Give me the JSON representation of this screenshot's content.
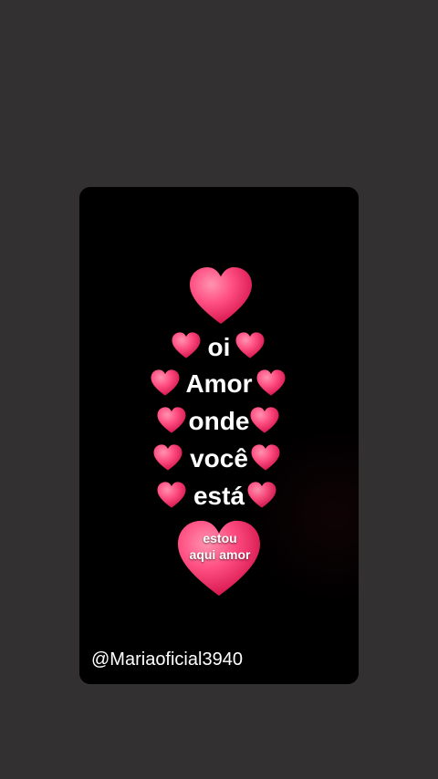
{
  "message": {
    "line1": "oi",
    "line2": "Amor",
    "line3": "onde",
    "line4": "você",
    "line5": "está"
  },
  "big_heart_text": {
    "line1": "estou",
    "line2": "aqui amor"
  },
  "handle": "@Mariaoficial3940",
  "colors": {
    "background": "#323030",
    "card": "#000000",
    "heart_light": "#ff6d95",
    "heart_dark": "#e0194f"
  },
  "icons": [
    "heart-icon"
  ]
}
